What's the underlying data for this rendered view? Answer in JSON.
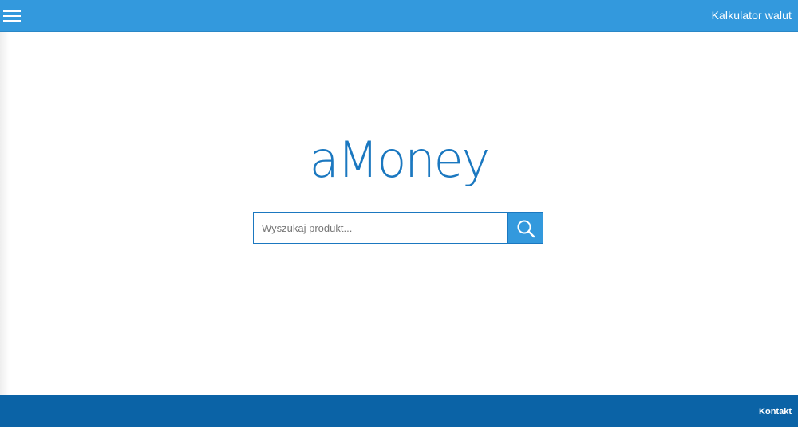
{
  "header": {
    "menu_icon": "hamburger-menu-icon",
    "calculator_link": "Kalkulator walut",
    "background_color": "#3399dd"
  },
  "main": {
    "logo_text": "aMoney",
    "logo_color": "#1b78c0",
    "search": {
      "placeholder": "Wyszukaj produkt...",
      "value": "",
      "button_icon": "search-icon"
    }
  },
  "footer": {
    "contact_link": "Kontakt",
    "background_color": "#0b63a6"
  }
}
